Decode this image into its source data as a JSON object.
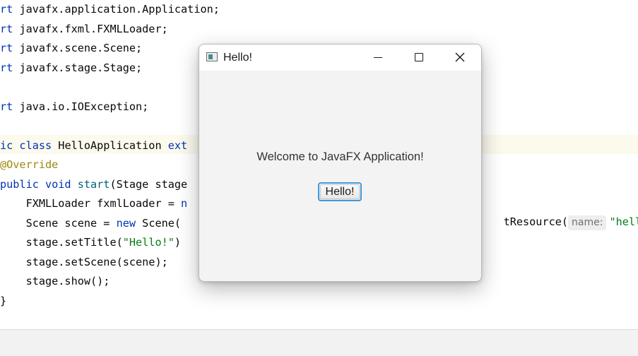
{
  "editor": {
    "lines": [
      {
        "parts": [
          {
            "t": "rt ",
            "c": "kw"
          },
          {
            "t": "javafx.application.Application;"
          }
        ]
      },
      {
        "parts": [
          {
            "t": "rt ",
            "c": "kw"
          },
          {
            "t": "javafx.fxml.FXMLLoader;"
          }
        ]
      },
      {
        "parts": [
          {
            "t": "rt ",
            "c": "kw"
          },
          {
            "t": "javafx.scene.Scene;"
          }
        ]
      },
      {
        "parts": [
          {
            "t": "rt ",
            "c": "kw"
          },
          {
            "t": "javafx.stage.Stage;"
          }
        ]
      },
      {
        "parts": []
      },
      {
        "parts": [
          {
            "t": "rt ",
            "c": "kw"
          },
          {
            "t": "java.io.IOException;"
          }
        ]
      },
      {
        "parts": []
      },
      {
        "parts": [
          {
            "t": "ic class ",
            "c": "kw"
          },
          {
            "t": "HelloApplication "
          },
          {
            "t": "ext",
            "c": "kw"
          }
        ]
      },
      {
        "parts": [
          {
            "t": "@Override",
            "c": "ann"
          }
        ]
      },
      {
        "parts": [
          {
            "t": "public void ",
            "c": "kw"
          },
          {
            "t": "start",
            "c": "fn"
          },
          {
            "t": "(Stage stage"
          }
        ]
      },
      {
        "parts": [
          {
            "t": "    FXMLLoader fxmlLoader = "
          },
          {
            "t": "n",
            "c": "kw"
          }
        ]
      },
      {
        "parts": [
          {
            "t": "    Scene scene = "
          },
          {
            "t": "new ",
            "c": "kw"
          },
          {
            "t": "Scene("
          }
        ]
      },
      {
        "parts": [
          {
            "t": "    stage.setTitle("
          },
          {
            "t": "\"Hello!\"",
            "c": "str"
          },
          {
            "t": ")"
          }
        ]
      },
      {
        "parts": [
          {
            "t": "    stage.setScene(scene);"
          }
        ]
      },
      {
        "parts": [
          {
            "t": "    stage.show();"
          }
        ]
      },
      {
        "parts": [
          {
            "t": "}"
          }
        ]
      }
    ],
    "right_fragment": {
      "code": "tResource(",
      "hint": "name:",
      "string": "\"hello-"
    }
  },
  "dialog": {
    "title": "Hello!",
    "welcome_text": "Welcome to JavaFX Application!",
    "button_label": "Hello!"
  }
}
